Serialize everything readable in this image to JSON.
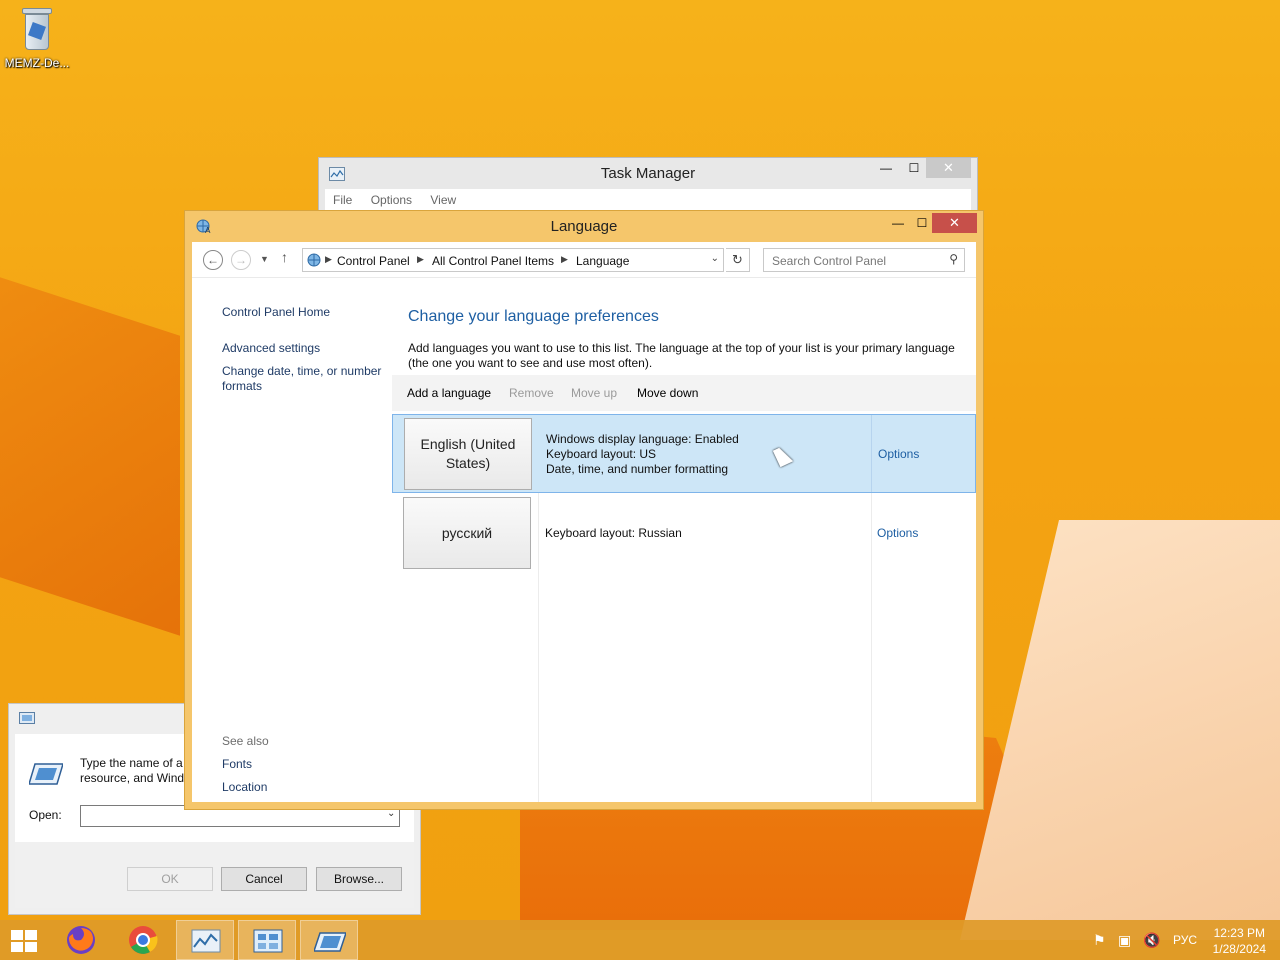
{
  "desktop": {
    "recycle_bin_label": "MEMZ-De..."
  },
  "task_manager": {
    "title": "Task Manager",
    "menu": [
      "File",
      "Options",
      "View"
    ]
  },
  "language_window": {
    "title": "Language",
    "breadcrumb": [
      "Control Panel",
      "All Control Panel Items",
      "Language"
    ],
    "search_placeholder": "Search Control Panel",
    "left_pane": {
      "home": "Control Panel Home",
      "advanced": "Advanced settings",
      "change_date": "Change date, time, or number formats",
      "see_also": "See also",
      "fonts": "Fonts",
      "location": "Location"
    },
    "heading": "Change your language preferences",
    "description": "Add languages you want to use to this list. The language at the top of your list is your primary language (the one you want to see and use most often).",
    "toolbar": {
      "add": "Add a language",
      "remove": "Remove",
      "move_up": "Move up",
      "move_down": "Move down"
    },
    "languages": [
      {
        "name": "English (United States)",
        "info": [
          "Windows display language: Enabled",
          "Keyboard layout: US",
          "Date, time, and number formatting"
        ],
        "options": "Options",
        "selected": true
      },
      {
        "name": "русский",
        "info": [
          "Keyboard layout: Russian"
        ],
        "options": "Options",
        "selected": false
      }
    ]
  },
  "run_dialog": {
    "prompt": "Type the name of a\nresource, and Windo",
    "open_label": "Open:",
    "open_value": "",
    "ok": "OK",
    "cancel": "Cancel",
    "browse": "Browse..."
  },
  "taskbar": {
    "language_indicator": "РУС",
    "time": "12:23 PM",
    "date": "1/28/2024",
    "items": [
      "start-button",
      "firefox",
      "chrome",
      "task-manager",
      "control-panel",
      "run"
    ]
  },
  "colors": {
    "wallpaper": "#f4a312",
    "window_frame": "#f5c66b",
    "close_button": "#c7504a",
    "selection": "#cde6f7",
    "link": "#1e5fa3"
  }
}
